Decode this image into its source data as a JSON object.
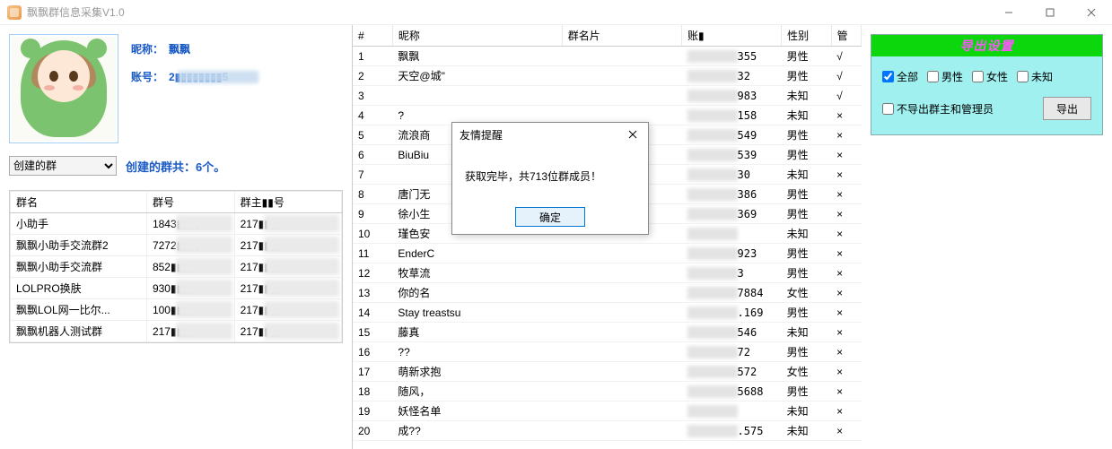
{
  "window": {
    "title": "飘飘群信息采集V1.0",
    "min": "—",
    "max": "□",
    "close": "×"
  },
  "profile": {
    "nick_label": "昵称：",
    "nick_value": "飘飘",
    "acct_label": "账号：",
    "acct_value": "2▮▮▮▮▮▮▮▮5"
  },
  "group_filter": {
    "selected": "创建的群",
    "count_text": "创建的群共：6个。"
  },
  "group_table": {
    "headers": [
      "群名",
      "群号",
      "群主▮▮号"
    ],
    "rows": [
      {
        "name": "小助手",
        "gid": "1843▮▮▮▮",
        "owner": "217▮▮▮▮5"
      },
      {
        "name": "飘飘小助手交流群2",
        "gid": "7272▮▮▮▮",
        "owner": "217▮▮▮▮5"
      },
      {
        "name": "飘飘小助手交流群",
        "gid": "852▮▮▮▮",
        "owner": "217▮▮▮▮5"
      },
      {
        "name": "LOLPRO换肤",
        "gid": "930▮▮▮▮",
        "owner": "217▮▮▮▮5"
      },
      {
        "name": "飘飘LOL网一比尔...",
        "gid": "100▮▮▮▮3",
        "owner": "217▮▮▮▮5"
      },
      {
        "name": "飘飘机器人测试群",
        "gid": "217▮▮▮▮",
        "owner": "217▮▮▮▮5"
      }
    ]
  },
  "member_table": {
    "headers": [
      "#",
      "昵称",
      "群名片",
      "账▮",
      "性别",
      "管"
    ],
    "rows": [
      {
        "i": 1,
        "nick": "飘飘",
        "card": "",
        "acct_tail": "355",
        "sex": "男性",
        "admin": "√"
      },
      {
        "i": 2,
        "nick": "天空@城\"",
        "card": "",
        "acct_tail": "32",
        "sex": "男性",
        "admin": "√"
      },
      {
        "i": 3,
        "nick": "",
        "card": "",
        "acct_tail": "983",
        "sex": "未知",
        "admin": "√"
      },
      {
        "i": 4,
        "nick": "?&nbsp",
        "card": "",
        "acct_tail": "158",
        "sex": "未知",
        "admin": "×"
      },
      {
        "i": 5,
        "nick": "流浪商",
        "card": "",
        "acct_tail": "549",
        "sex": "男性",
        "admin": "×"
      },
      {
        "i": 6,
        "nick": "BiuBiu",
        "card": "",
        "acct_tail": "539",
        "sex": "男性",
        "admin": "×"
      },
      {
        "i": 7,
        "nick": "",
        "card": "",
        "acct_tail": "30",
        "sex": "未知",
        "admin": "×"
      },
      {
        "i": 8,
        "nick": "唐门无",
        "card": "",
        "acct_tail": "386",
        "sex": "男性",
        "admin": "×"
      },
      {
        "i": 9,
        "nick": "徐小生",
        "card": "",
        "acct_tail": "369",
        "sex": "男性",
        "admin": "×"
      },
      {
        "i": 10,
        "nick": "瑾色安",
        "card": "",
        "acct_tail": "",
        "sex": "未知",
        "admin": "×"
      },
      {
        "i": 11,
        "nick": "EnderC",
        "card": "",
        "acct_tail": "923",
        "sex": "男性",
        "admin": "×"
      },
      {
        "i": 12,
        "nick": "牧草流",
        "card": "",
        "acct_tail": "3",
        "sex": "男性",
        "admin": "×"
      },
      {
        "i": 13,
        "nick": "你的名",
        "card": "",
        "acct_tail": "7884",
        "sex": "女性",
        "admin": "×"
      },
      {
        "i": 14,
        "nick": "Stay&nbsp;treastsu",
        "card": "",
        "acct_tail": ".169",
        "sex": "男性",
        "admin": "×"
      },
      {
        "i": 15,
        "nick": "藤真",
        "card": "",
        "acct_tail": "546",
        "sex": "未知",
        "admin": "×"
      },
      {
        "i": 16,
        "nick": "??",
        "card": "",
        "acct_tail": "72",
        "sex": "男性",
        "admin": "×"
      },
      {
        "i": 17,
        "nick": "萌新求抱",
        "card": "",
        "acct_tail": "572",
        "sex": "女性",
        "admin": "×"
      },
      {
        "i": 18,
        "nick": "随风，",
        "card": "",
        "acct_tail": "5688",
        "sex": "男性",
        "admin": "×"
      },
      {
        "i": 19,
        "nick": "妖怪名单",
        "card": "",
        "acct_tail": "",
        "sex": "未知",
        "admin": "×"
      },
      {
        "i": 20,
        "nick": "成??",
        "card": "",
        "acct_tail": ".575",
        "sex": "未知",
        "admin": "×"
      }
    ]
  },
  "dialog": {
    "title": "友情提醒",
    "body": "获取完毕，共713位群成员！",
    "ok": "确定"
  },
  "export": {
    "title": "导出设置",
    "opt_all": "全部",
    "opt_male": "男性",
    "opt_female": "女性",
    "opt_unknown": "未知",
    "opt_exclude": "不导出群主和管理员",
    "btn": "导出"
  }
}
